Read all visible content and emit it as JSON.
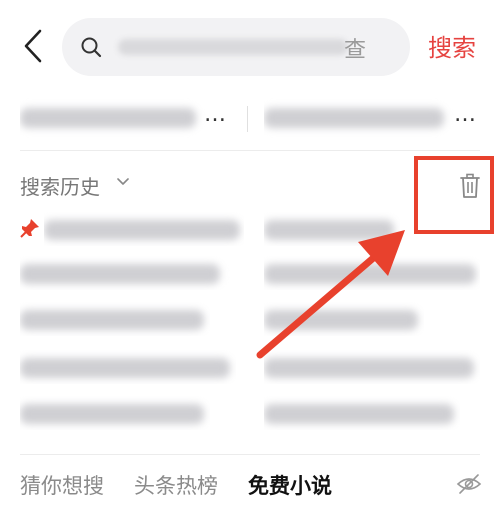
{
  "header": {
    "search_trailing_text": "查",
    "search_button_label": "搜索"
  },
  "suggestions": [
    {
      "ellipsis": "…"
    },
    {
      "ellipsis": "…"
    }
  ],
  "history": {
    "title": "搜索历史"
  },
  "tabs": [
    {
      "label": "猜你想搜",
      "active": false
    },
    {
      "label": "头条热榜",
      "active": false
    },
    {
      "label": "免费小说",
      "active": true
    }
  ],
  "colors": {
    "accent": "#e64340",
    "highlight": "#e8412d"
  },
  "icons": [
    "back-arrow-icon",
    "search-icon",
    "chevron-down-icon",
    "trash-icon",
    "pin-icon",
    "eye-off-icon"
  ]
}
